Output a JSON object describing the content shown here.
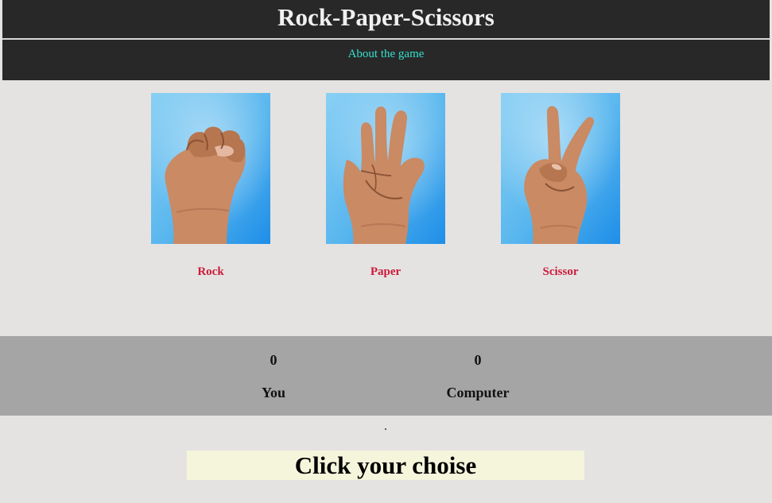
{
  "header": {
    "title": "Rock-Paper-Scissors",
    "about_link": "About the game"
  },
  "choices": [
    {
      "label": "Rock",
      "icon": "rock-hand-icon"
    },
    {
      "label": "Paper",
      "icon": "paper-hand-icon"
    },
    {
      "label": "Scissor",
      "icon": "scissors-hand-icon"
    }
  ],
  "scoreboard": {
    "you_score": "0",
    "you_label": "You",
    "computer_score": "0",
    "computer_label": "Computer"
  },
  "message": "Click your choise",
  "colors": {
    "header_bg": "#282828",
    "page_bg": "#e4e3e1",
    "about_link": "#36e0cf",
    "choice_label": "#cc1a3a",
    "score_band": "#a5a5a5",
    "message_bg": "#f5f5dc"
  }
}
